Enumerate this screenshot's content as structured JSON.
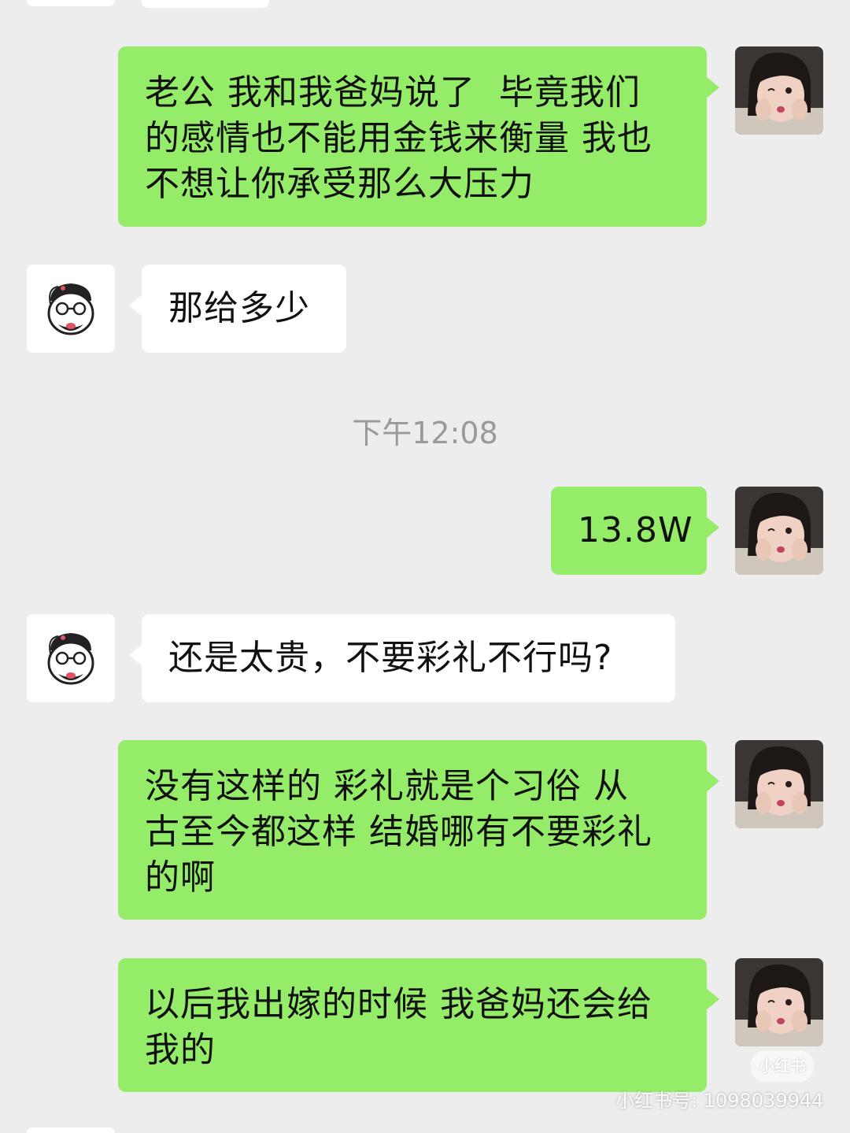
{
  "chat": {
    "messages": [
      {
        "sender": "me",
        "text": "老公 我和我爸妈说了  毕竟我们\n的感情也不能用金钱来衡量 我也\n不想让你承受那么大压力"
      },
      {
        "sender": "other",
        "text": "那给多少"
      },
      {
        "sender": "me",
        "text": "13.8W"
      },
      {
        "sender": "other",
        "text": "还是太贵，不要彩礼不行吗?"
      },
      {
        "sender": "me",
        "text": "没有这样的 彩礼就是个习俗 从\n古至今都这样 结婚哪有不要彩礼\n的啊"
      },
      {
        "sender": "me",
        "text": "以后我出嫁的时候 我爸妈还会给\n我的"
      }
    ],
    "timestamp": "下午12:08"
  },
  "watermark": {
    "logo_text": "小红书",
    "id_text": "小红书号: 1098039944"
  },
  "colors": {
    "background": "#ededed",
    "my_bubble": "#95ec69",
    "other_bubble": "#ffffff",
    "timestamp_text": "#9a9a9a"
  },
  "icons": {
    "my_avatar": "girl-photo-avatar",
    "other_avatar": "cartoon-face-avatar"
  }
}
